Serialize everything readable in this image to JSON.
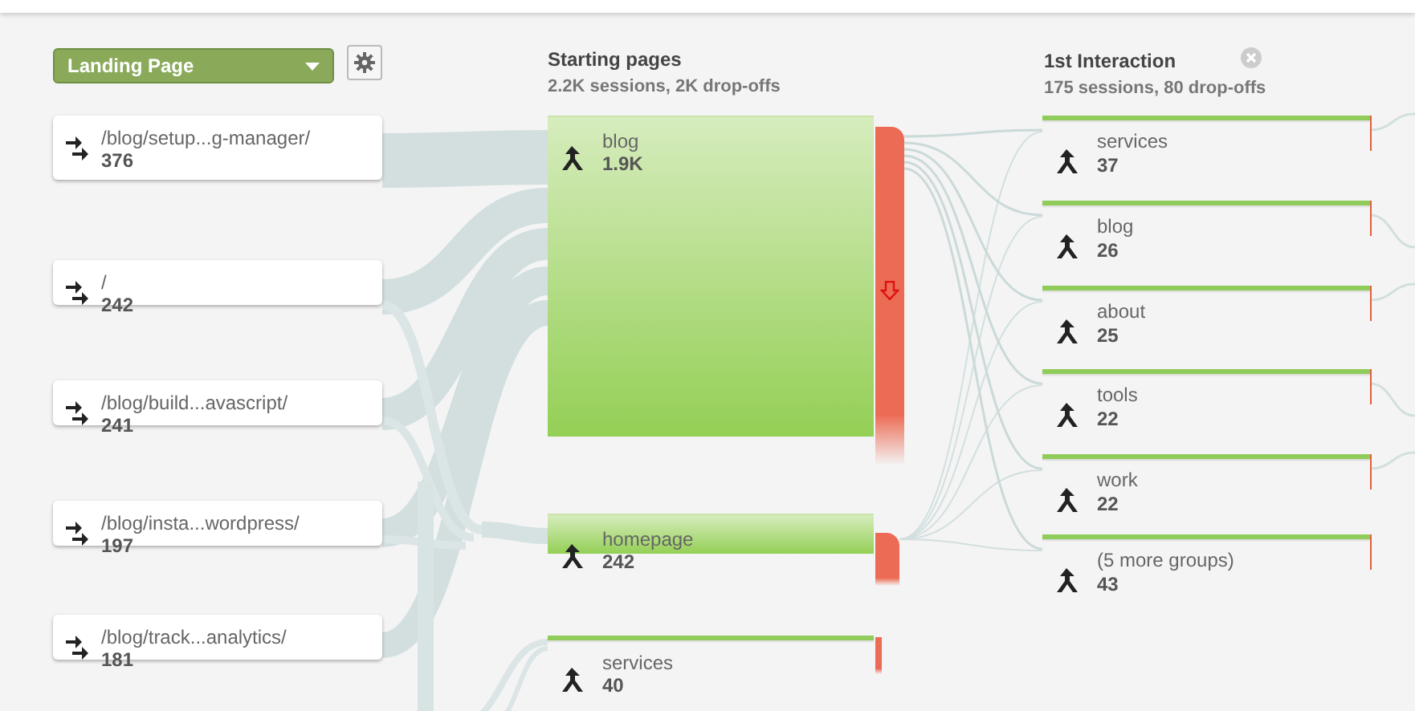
{
  "dimension_select": {
    "value": "Landing Page"
  },
  "landing_pages": [
    {
      "label": "/blog/setup...g-manager/",
      "count": "376"
    },
    {
      "label": "/",
      "count": "242"
    },
    {
      "label": "/blog/build...avascript/",
      "count": "241"
    },
    {
      "label": "/blog/insta...wordpress/",
      "count": "197"
    },
    {
      "label": "/blog/track...analytics/",
      "count": "181"
    }
  ],
  "starting_pages": {
    "title": "Starting pages",
    "summary": "2.2K sessions, 2K drop-offs",
    "nodes": [
      {
        "label": "blog",
        "count": "1.9K"
      },
      {
        "label": "homepage",
        "count": "242"
      },
      {
        "label": "services",
        "count": "40"
      }
    ]
  },
  "first_interaction": {
    "title": "1st Interaction",
    "summary": "175 sessions, 80 drop-offs",
    "nodes": [
      {
        "label": "services",
        "count": "37"
      },
      {
        "label": "blog",
        "count": "26"
      },
      {
        "label": "about",
        "count": "25"
      },
      {
        "label": "tools",
        "count": "22"
      },
      {
        "label": "work",
        "count": "22"
      },
      {
        "label": "(5 more groups)",
        "count": "43"
      }
    ]
  }
}
